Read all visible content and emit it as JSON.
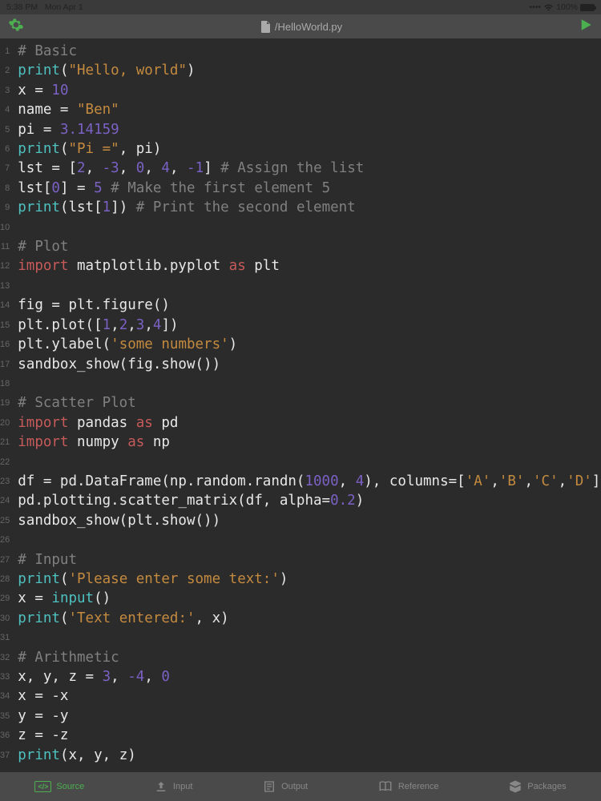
{
  "status_bar": {
    "time": "5:38 PM",
    "date": "Mon Apr 1",
    "signal": "••••",
    "wifi": "􀙇",
    "battery_pct": "100%"
  },
  "top_bar": {
    "filename": "/HelloWorld.py"
  },
  "gutter_lines": [
    "1",
    "2",
    "3",
    "4",
    "5",
    "6",
    "7",
    "8",
    "9",
    "10",
    "11",
    "12",
    "13",
    "14",
    "15",
    "16",
    "17",
    "18",
    "19",
    "20",
    "21",
    "22",
    "23",
    "24",
    "25",
    "26",
    "27",
    "28",
    "29",
    "30",
    "31",
    "32",
    "33",
    "34",
    "35",
    "36",
    "37"
  ],
  "code_lines": [
    [
      {
        "t": "# Basic",
        "c": "comment"
      }
    ],
    [
      {
        "t": "print",
        "c": "func"
      },
      {
        "t": "(",
        "c": "default"
      },
      {
        "t": "\"Hello, world\"",
        "c": "string"
      },
      {
        "t": ")",
        "c": "default"
      }
    ],
    [
      {
        "t": "x = ",
        "c": "default"
      },
      {
        "t": "10",
        "c": "number"
      }
    ],
    [
      {
        "t": "name = ",
        "c": "default"
      },
      {
        "t": "\"Ben\"",
        "c": "string"
      }
    ],
    [
      {
        "t": "pi = ",
        "c": "default"
      },
      {
        "t": "3.14159",
        "c": "number"
      }
    ],
    [
      {
        "t": "print",
        "c": "func"
      },
      {
        "t": "(",
        "c": "default"
      },
      {
        "t": "\"Pi =\"",
        "c": "string"
      },
      {
        "t": ", pi)",
        "c": "default"
      }
    ],
    [
      {
        "t": "lst = [",
        "c": "default"
      },
      {
        "t": "2",
        "c": "number"
      },
      {
        "t": ", ",
        "c": "default"
      },
      {
        "t": "-3",
        "c": "number"
      },
      {
        "t": ", ",
        "c": "default"
      },
      {
        "t": "0",
        "c": "number"
      },
      {
        "t": ", ",
        "c": "default"
      },
      {
        "t": "4",
        "c": "number"
      },
      {
        "t": ", ",
        "c": "default"
      },
      {
        "t": "-1",
        "c": "number"
      },
      {
        "t": "] ",
        "c": "default"
      },
      {
        "t": "# Assign the list",
        "c": "comment"
      }
    ],
    [
      {
        "t": "lst[",
        "c": "default"
      },
      {
        "t": "0",
        "c": "number"
      },
      {
        "t": "] = ",
        "c": "default"
      },
      {
        "t": "5",
        "c": "number"
      },
      {
        "t": " ",
        "c": "default"
      },
      {
        "t": "# Make the first element 5",
        "c": "comment"
      }
    ],
    [
      {
        "t": "print",
        "c": "func"
      },
      {
        "t": "(lst[",
        "c": "default"
      },
      {
        "t": "1",
        "c": "number"
      },
      {
        "t": "]) ",
        "c": "default"
      },
      {
        "t": "# Print the second element",
        "c": "comment"
      }
    ],
    [
      {
        "t": "",
        "c": "default"
      }
    ],
    [
      {
        "t": "# Plot",
        "c": "comment"
      }
    ],
    [
      {
        "t": "import",
        "c": "keyword"
      },
      {
        "t": " matplotlib.pyplot ",
        "c": "default"
      },
      {
        "t": "as",
        "c": "keyword"
      },
      {
        "t": " plt",
        "c": "default"
      }
    ],
    [
      {
        "t": "",
        "c": "default"
      }
    ],
    [
      {
        "t": "fig = plt.figure()",
        "c": "default"
      }
    ],
    [
      {
        "t": "plt.plot([",
        "c": "default"
      },
      {
        "t": "1",
        "c": "number"
      },
      {
        "t": ",",
        "c": "default"
      },
      {
        "t": "2",
        "c": "number"
      },
      {
        "t": ",",
        "c": "default"
      },
      {
        "t": "3",
        "c": "number"
      },
      {
        "t": ",",
        "c": "default"
      },
      {
        "t": "4",
        "c": "number"
      },
      {
        "t": "])",
        "c": "default"
      }
    ],
    [
      {
        "t": "plt.ylabel(",
        "c": "default"
      },
      {
        "t": "'some numbers'",
        "c": "string"
      },
      {
        "t": ")",
        "c": "default"
      }
    ],
    [
      {
        "t": "sandbox_show(fig.show())",
        "c": "default"
      }
    ],
    [
      {
        "t": "",
        "c": "default"
      }
    ],
    [
      {
        "t": "# Scatter Plot",
        "c": "comment"
      }
    ],
    [
      {
        "t": "import",
        "c": "keyword"
      },
      {
        "t": " pandas ",
        "c": "default"
      },
      {
        "t": "as",
        "c": "keyword"
      },
      {
        "t": " pd",
        "c": "default"
      }
    ],
    [
      {
        "t": "import",
        "c": "keyword"
      },
      {
        "t": " numpy ",
        "c": "default"
      },
      {
        "t": "as",
        "c": "keyword"
      },
      {
        "t": " np",
        "c": "default"
      }
    ],
    [
      {
        "t": "",
        "c": "default"
      }
    ],
    [
      {
        "t": "df = pd.DataFrame(np.random.randn(",
        "c": "default"
      },
      {
        "t": "1000",
        "c": "number"
      },
      {
        "t": ", ",
        "c": "default"
      },
      {
        "t": "4",
        "c": "number"
      },
      {
        "t": "), columns=[",
        "c": "default"
      },
      {
        "t": "'A'",
        "c": "string"
      },
      {
        "t": ",",
        "c": "default"
      },
      {
        "t": "'B'",
        "c": "string"
      },
      {
        "t": ",",
        "c": "default"
      },
      {
        "t": "'C'",
        "c": "string"
      },
      {
        "t": ",",
        "c": "default"
      },
      {
        "t": "'D'",
        "c": "string"
      },
      {
        "t": "])",
        "c": "default"
      }
    ],
    [
      {
        "t": "pd.plotting.scatter_matrix(df, alpha=",
        "c": "default"
      },
      {
        "t": "0.2",
        "c": "number"
      },
      {
        "t": ")",
        "c": "default"
      }
    ],
    [
      {
        "t": "sandbox_show(plt.show())",
        "c": "default"
      }
    ],
    [
      {
        "t": "",
        "c": "default"
      }
    ],
    [
      {
        "t": "# Input",
        "c": "comment"
      }
    ],
    [
      {
        "t": "print",
        "c": "func"
      },
      {
        "t": "(",
        "c": "default"
      },
      {
        "t": "'Please enter some text:'",
        "c": "string"
      },
      {
        "t": ")",
        "c": "default"
      }
    ],
    [
      {
        "t": "x = ",
        "c": "default"
      },
      {
        "t": "input",
        "c": "func"
      },
      {
        "t": "()",
        "c": "default"
      }
    ],
    [
      {
        "t": "print",
        "c": "func"
      },
      {
        "t": "(",
        "c": "default"
      },
      {
        "t": "'Text entered:'",
        "c": "string"
      },
      {
        "t": ", x)",
        "c": "default"
      }
    ],
    [
      {
        "t": "",
        "c": "default"
      }
    ],
    [
      {
        "t": "# Arithmetic",
        "c": "comment"
      }
    ],
    [
      {
        "t": "x, y, z = ",
        "c": "default"
      },
      {
        "t": "3",
        "c": "number"
      },
      {
        "t": ", ",
        "c": "default"
      },
      {
        "t": "-4",
        "c": "number"
      },
      {
        "t": ", ",
        "c": "default"
      },
      {
        "t": "0",
        "c": "number"
      }
    ],
    [
      {
        "t": "x = -x",
        "c": "default"
      }
    ],
    [
      {
        "t": "y = -y",
        "c": "default"
      }
    ],
    [
      {
        "t": "z = -z",
        "c": "default"
      }
    ],
    [
      {
        "t": "print",
        "c": "func"
      },
      {
        "t": "(x, y, z)",
        "c": "default"
      }
    ]
  ],
  "bottom_tabs": {
    "source": "Source",
    "input": "Input",
    "output": "Output",
    "reference": "Reference",
    "packages": "Packages"
  }
}
